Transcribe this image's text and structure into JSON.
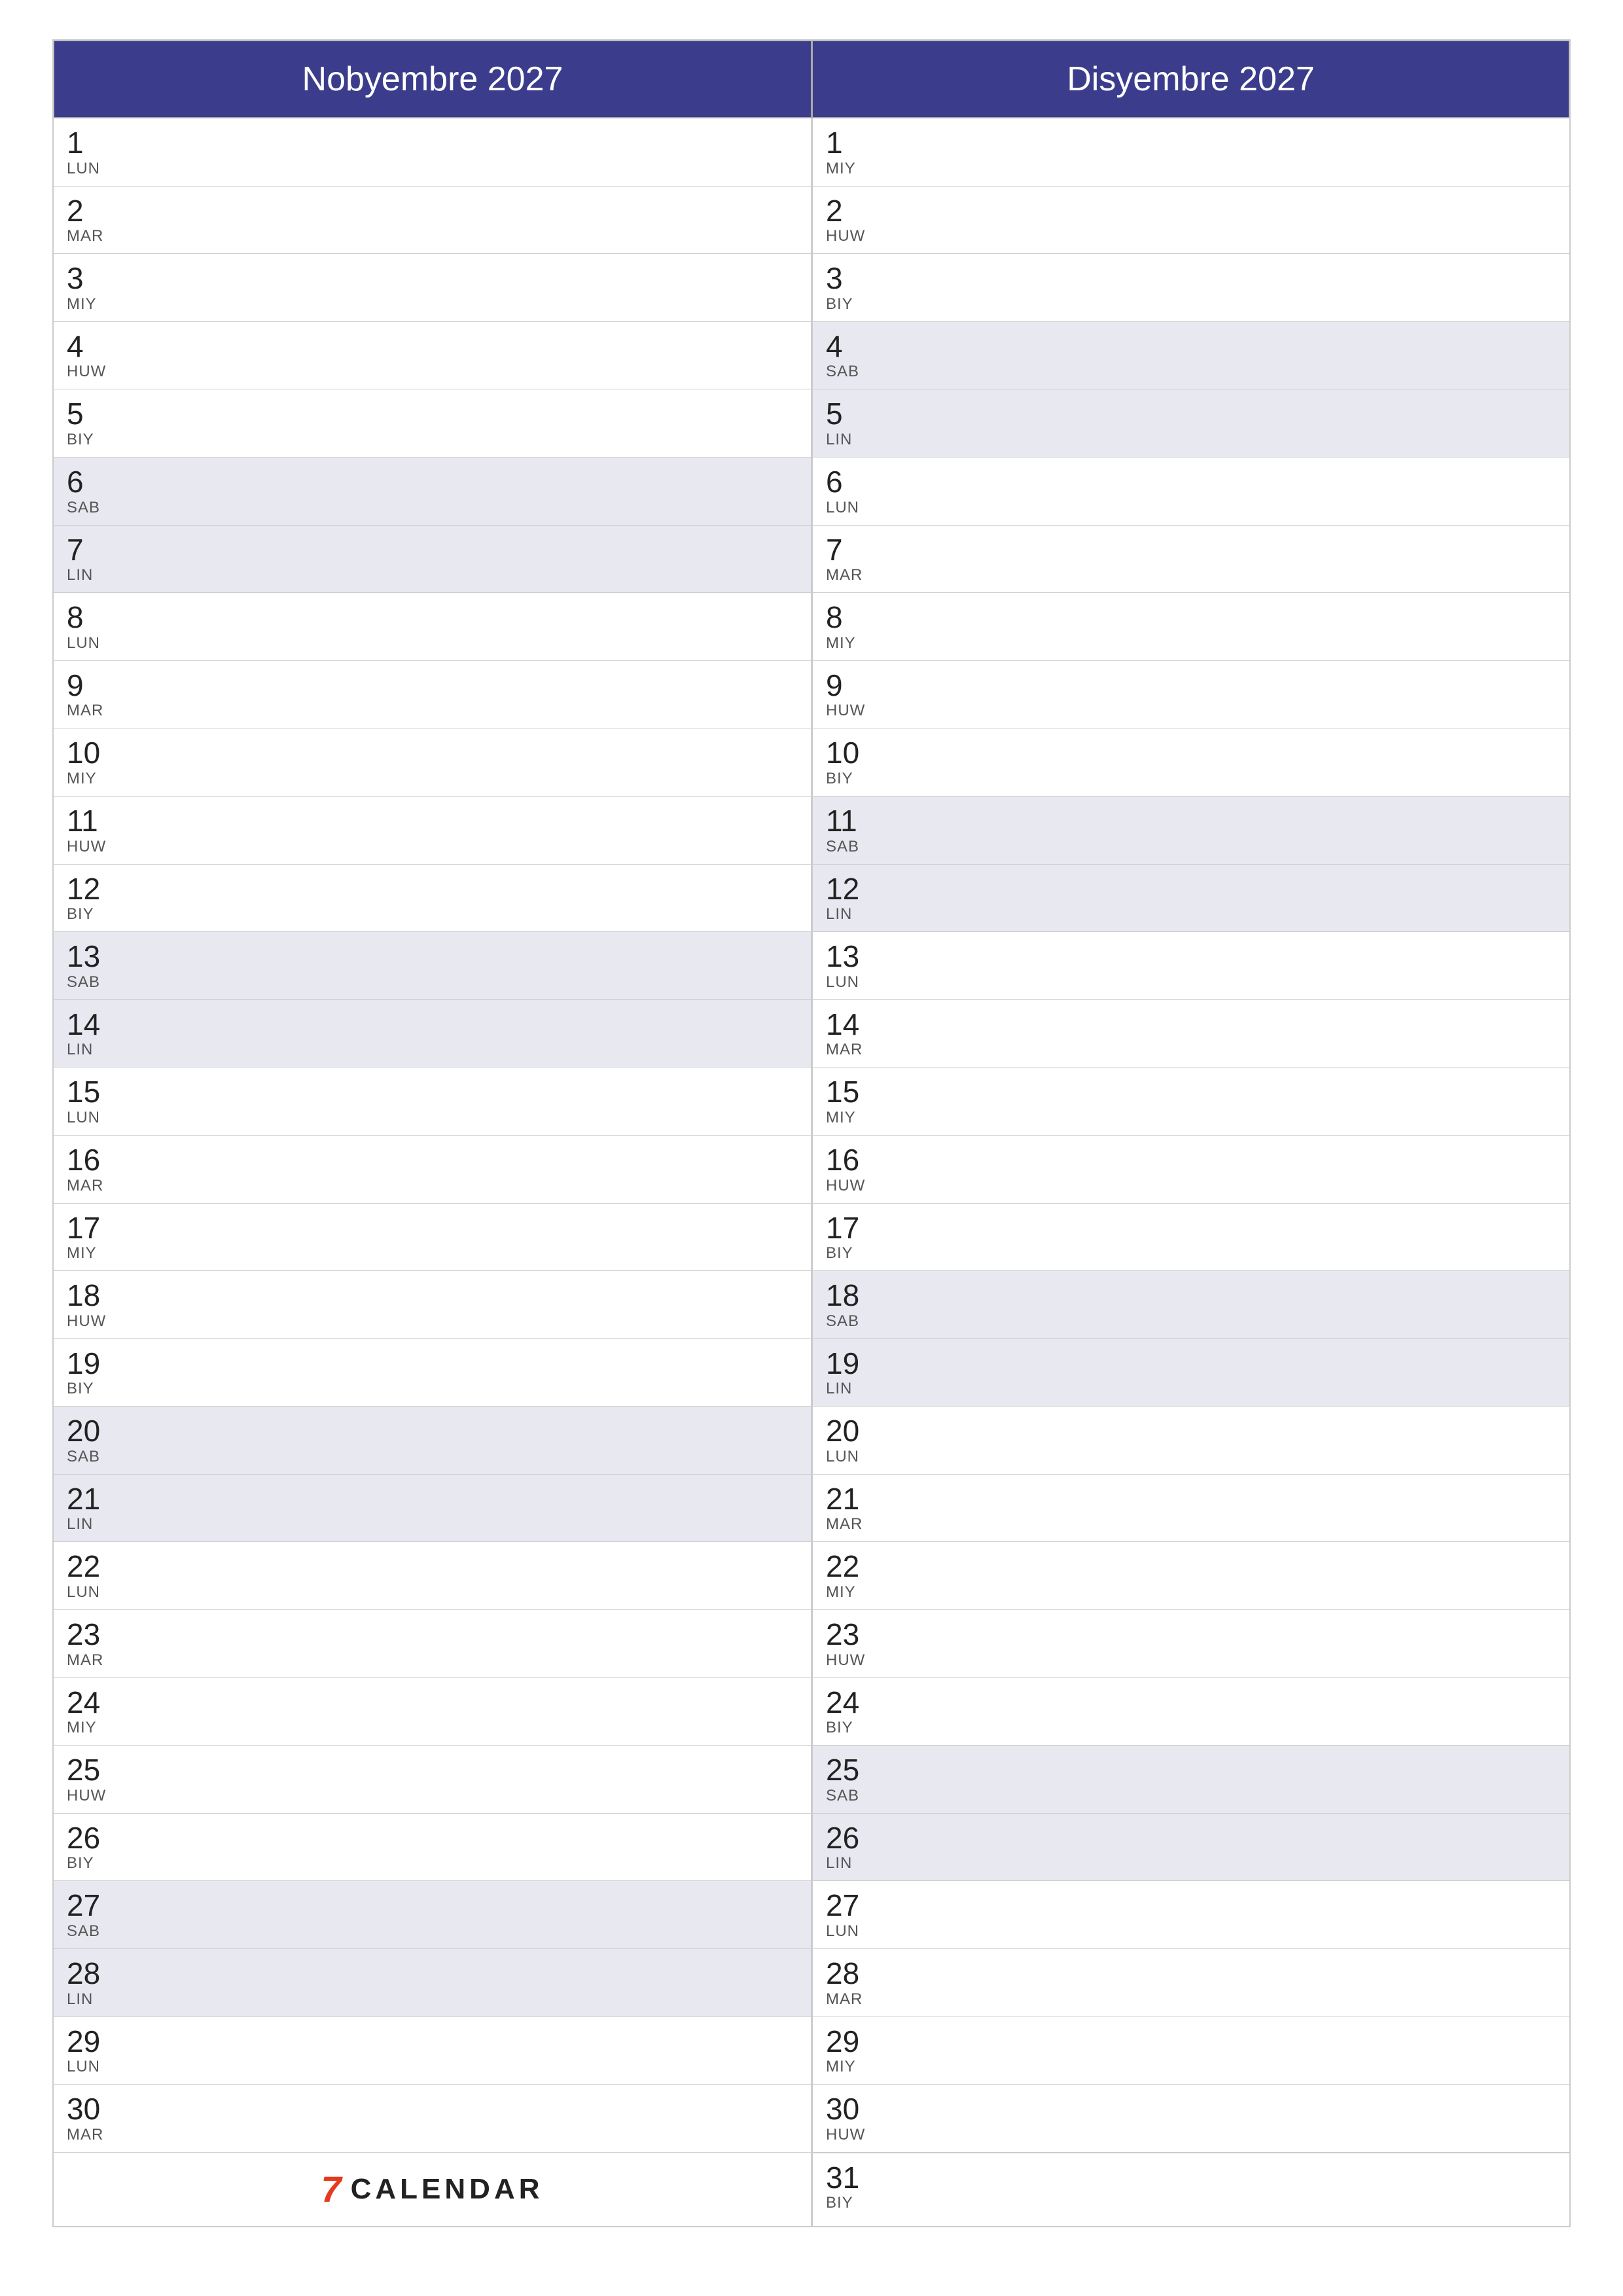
{
  "months": {
    "left": "Nobyembre 2027",
    "right": "Disyembre 2027"
  },
  "footer": {
    "logo_text": "CALENDAR",
    "logo_symbol": "7"
  },
  "november": [
    {
      "num": "1",
      "day": "LUN",
      "weekend": false
    },
    {
      "num": "2",
      "day": "MAR",
      "weekend": false
    },
    {
      "num": "3",
      "day": "MIY",
      "weekend": false
    },
    {
      "num": "4",
      "day": "HUW",
      "weekend": false
    },
    {
      "num": "5",
      "day": "BIY",
      "weekend": false
    },
    {
      "num": "6",
      "day": "SAB",
      "weekend": true
    },
    {
      "num": "7",
      "day": "LIN",
      "weekend": true
    },
    {
      "num": "8",
      "day": "LUN",
      "weekend": false
    },
    {
      "num": "9",
      "day": "MAR",
      "weekend": false
    },
    {
      "num": "10",
      "day": "MIY",
      "weekend": false
    },
    {
      "num": "11",
      "day": "HUW",
      "weekend": false
    },
    {
      "num": "12",
      "day": "BIY",
      "weekend": false
    },
    {
      "num": "13",
      "day": "SAB",
      "weekend": true
    },
    {
      "num": "14",
      "day": "LIN",
      "weekend": true
    },
    {
      "num": "15",
      "day": "LUN",
      "weekend": false
    },
    {
      "num": "16",
      "day": "MAR",
      "weekend": false
    },
    {
      "num": "17",
      "day": "MIY",
      "weekend": false
    },
    {
      "num": "18",
      "day": "HUW",
      "weekend": false
    },
    {
      "num": "19",
      "day": "BIY",
      "weekend": false
    },
    {
      "num": "20",
      "day": "SAB",
      "weekend": true
    },
    {
      "num": "21",
      "day": "LIN",
      "weekend": true
    },
    {
      "num": "22",
      "day": "LUN",
      "weekend": false
    },
    {
      "num": "23",
      "day": "MAR",
      "weekend": false
    },
    {
      "num": "24",
      "day": "MIY",
      "weekend": false
    },
    {
      "num": "25",
      "day": "HUW",
      "weekend": false
    },
    {
      "num": "26",
      "day": "BIY",
      "weekend": false
    },
    {
      "num": "27",
      "day": "SAB",
      "weekend": true
    },
    {
      "num": "28",
      "day": "LIN",
      "weekend": true
    },
    {
      "num": "29",
      "day": "LUN",
      "weekend": false
    },
    {
      "num": "30",
      "day": "MAR",
      "weekend": false
    }
  ],
  "december": [
    {
      "num": "1",
      "day": "MIY",
      "weekend": false
    },
    {
      "num": "2",
      "day": "HUW",
      "weekend": false
    },
    {
      "num": "3",
      "day": "BIY",
      "weekend": false
    },
    {
      "num": "4",
      "day": "SAB",
      "weekend": true
    },
    {
      "num": "5",
      "day": "LIN",
      "weekend": true
    },
    {
      "num": "6",
      "day": "LUN",
      "weekend": false
    },
    {
      "num": "7",
      "day": "MAR",
      "weekend": false
    },
    {
      "num": "8",
      "day": "MIY",
      "weekend": false
    },
    {
      "num": "9",
      "day": "HUW",
      "weekend": false
    },
    {
      "num": "10",
      "day": "BIY",
      "weekend": false
    },
    {
      "num": "11",
      "day": "SAB",
      "weekend": true
    },
    {
      "num": "12",
      "day": "LIN",
      "weekend": true
    },
    {
      "num": "13",
      "day": "LUN",
      "weekend": false
    },
    {
      "num": "14",
      "day": "MAR",
      "weekend": false
    },
    {
      "num": "15",
      "day": "MIY",
      "weekend": false
    },
    {
      "num": "16",
      "day": "HUW",
      "weekend": false
    },
    {
      "num": "17",
      "day": "BIY",
      "weekend": false
    },
    {
      "num": "18",
      "day": "SAB",
      "weekend": true
    },
    {
      "num": "19",
      "day": "LIN",
      "weekend": true
    },
    {
      "num": "20",
      "day": "LUN",
      "weekend": false
    },
    {
      "num": "21",
      "day": "MAR",
      "weekend": false
    },
    {
      "num": "22",
      "day": "MIY",
      "weekend": false
    },
    {
      "num": "23",
      "day": "HUW",
      "weekend": false
    },
    {
      "num": "24",
      "day": "BIY",
      "weekend": false
    },
    {
      "num": "25",
      "day": "SAB",
      "weekend": true
    },
    {
      "num": "26",
      "day": "LIN",
      "weekend": true
    },
    {
      "num": "27",
      "day": "LUN",
      "weekend": false
    },
    {
      "num": "28",
      "day": "MAR",
      "weekend": false
    },
    {
      "num": "29",
      "day": "MIY",
      "weekend": false
    },
    {
      "num": "30",
      "day": "HUW",
      "weekend": false
    },
    {
      "num": "31",
      "day": "BIY",
      "weekend": false
    }
  ]
}
